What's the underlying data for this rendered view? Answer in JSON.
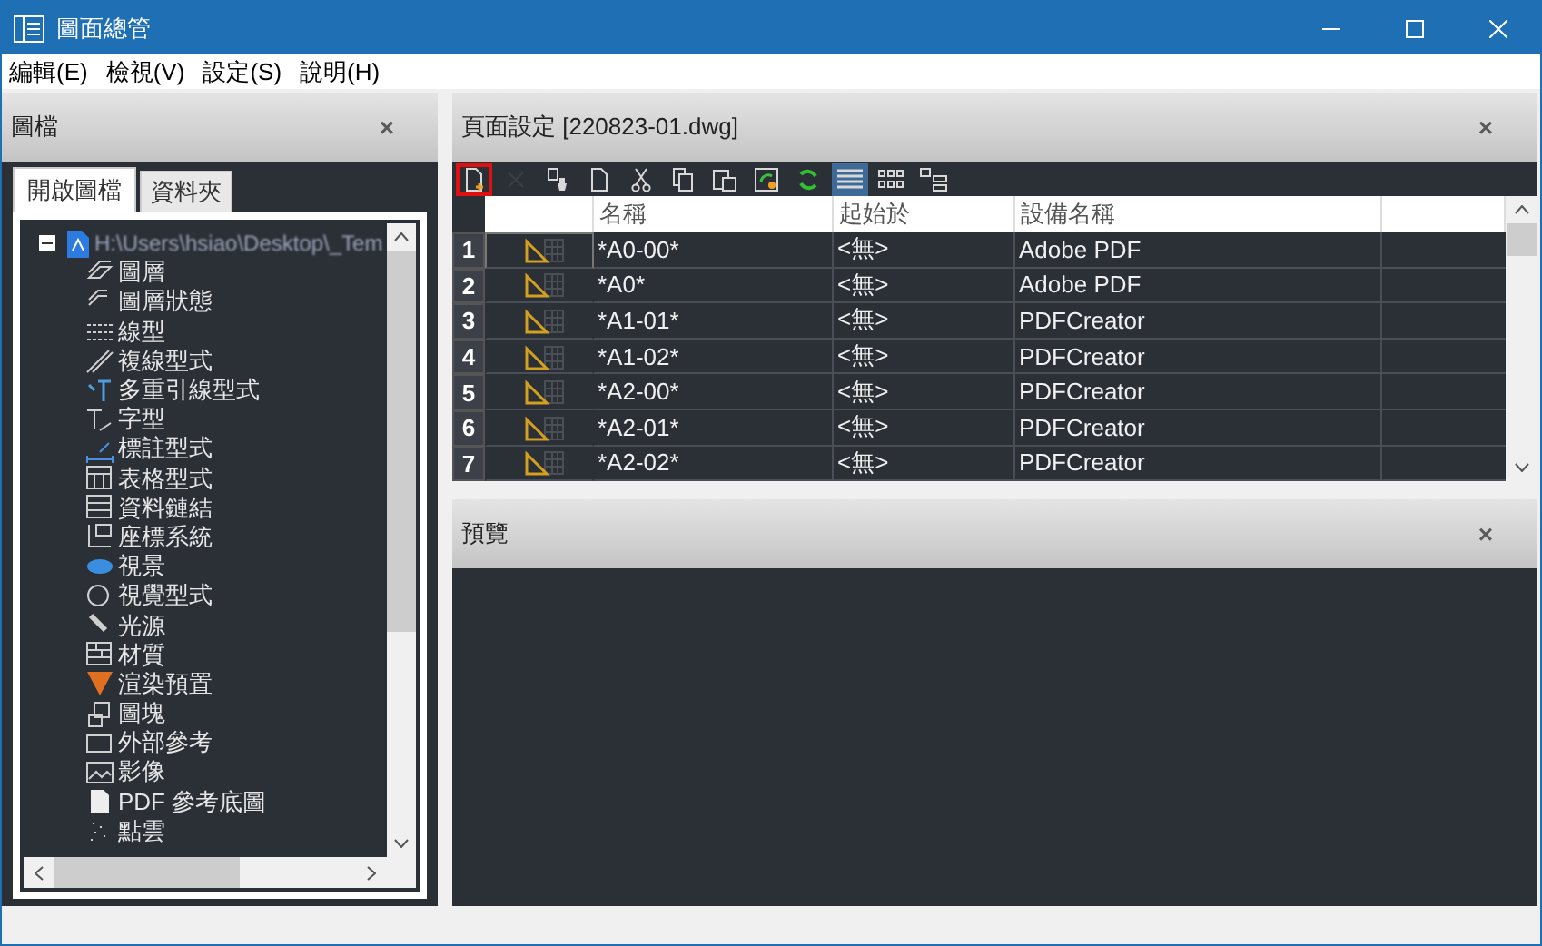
{
  "window": {
    "title": "圖面總管"
  },
  "menu": [
    "編輯(E)",
    "檢視(V)",
    "設定(S)",
    "說明(H)"
  ],
  "left_panel": {
    "title": "圖檔",
    "close": "×",
    "tabs": [
      {
        "label": "開啟圖檔",
        "selected": true
      },
      {
        "label": "資料夾",
        "selected": false
      }
    ],
    "tree": {
      "label": "H:\\Users\\hsiao\\Desktop\\_Tem",
      "expanded": true,
      "children": [
        {
          "label": "圖層"
        },
        {
          "label": "圖層狀態"
        },
        {
          "label": "線型"
        },
        {
          "label": "複線型式"
        },
        {
          "label": "多重引線型式"
        },
        {
          "label": "字型"
        },
        {
          "label": "標註型式"
        },
        {
          "label": "表格型式"
        },
        {
          "label": "資料鏈結"
        },
        {
          "label": "座標系統"
        },
        {
          "label": "視景"
        },
        {
          "label": "視覺型式"
        },
        {
          "label": "光源"
        },
        {
          "label": "材質"
        },
        {
          "label": "渲染預置"
        },
        {
          "label": "圖塊"
        },
        {
          "label": "外部參考"
        },
        {
          "label": "影像"
        },
        {
          "label": "PDF 參考底圖"
        },
        {
          "label": "點雲"
        }
      ]
    }
  },
  "page_setup": {
    "title": "頁面設定 [220823-01.dwg]",
    "close": "×",
    "toolbar": [
      {
        "kind": "new",
        "highlighted": true,
        "disabled": false
      },
      {
        "kind": "delete",
        "highlighted": false,
        "disabled": true
      },
      {
        "kind": "brush",
        "highlighted": false,
        "disabled": false
      },
      {
        "kind": "page",
        "highlighted": false,
        "disabled": false
      },
      {
        "kind": "cut",
        "highlighted": false,
        "disabled": false
      },
      {
        "kind": "copy",
        "highlighted": false,
        "disabled": false
      },
      {
        "kind": "paste",
        "highlighted": false,
        "disabled": false
      },
      {
        "kind": "import",
        "highlighted": false,
        "disabled": false
      },
      {
        "kind": "refresh",
        "highlighted": false,
        "disabled": false
      }
    ],
    "views": [
      {
        "kind": "list",
        "selected": true
      },
      {
        "kind": "grid",
        "selected": false
      },
      {
        "kind": "detail",
        "selected": false
      }
    ],
    "columns": [
      "名稱",
      "起始於",
      "設備名稱"
    ],
    "rows": [
      {
        "number": "1",
        "name": "*A0-00*",
        "from": "<無>",
        "device": "Adobe PDF",
        "selected": true
      },
      {
        "number": "2",
        "name": "*A0*",
        "from": "<無>",
        "device": "Adobe PDF",
        "selected": false
      },
      {
        "number": "3",
        "name": "*A1-01*",
        "from": "<無>",
        "device": "PDFCreator",
        "selected": false
      },
      {
        "number": "4",
        "name": "*A1-02*",
        "from": "<無>",
        "device": "PDFCreator",
        "selected": false
      },
      {
        "number": "5",
        "name": "*A2-00*",
        "from": "<無>",
        "device": "PDFCreator",
        "selected": false
      },
      {
        "number": "6",
        "name": "*A2-01*",
        "from": "<無>",
        "device": "PDFCreator",
        "selected": false
      },
      {
        "number": "7",
        "name": "*A2-02*",
        "from": "<無>",
        "device": "PDFCreator",
        "selected": false
      }
    ]
  },
  "preview": {
    "title": "預覽",
    "close": "×"
  }
}
